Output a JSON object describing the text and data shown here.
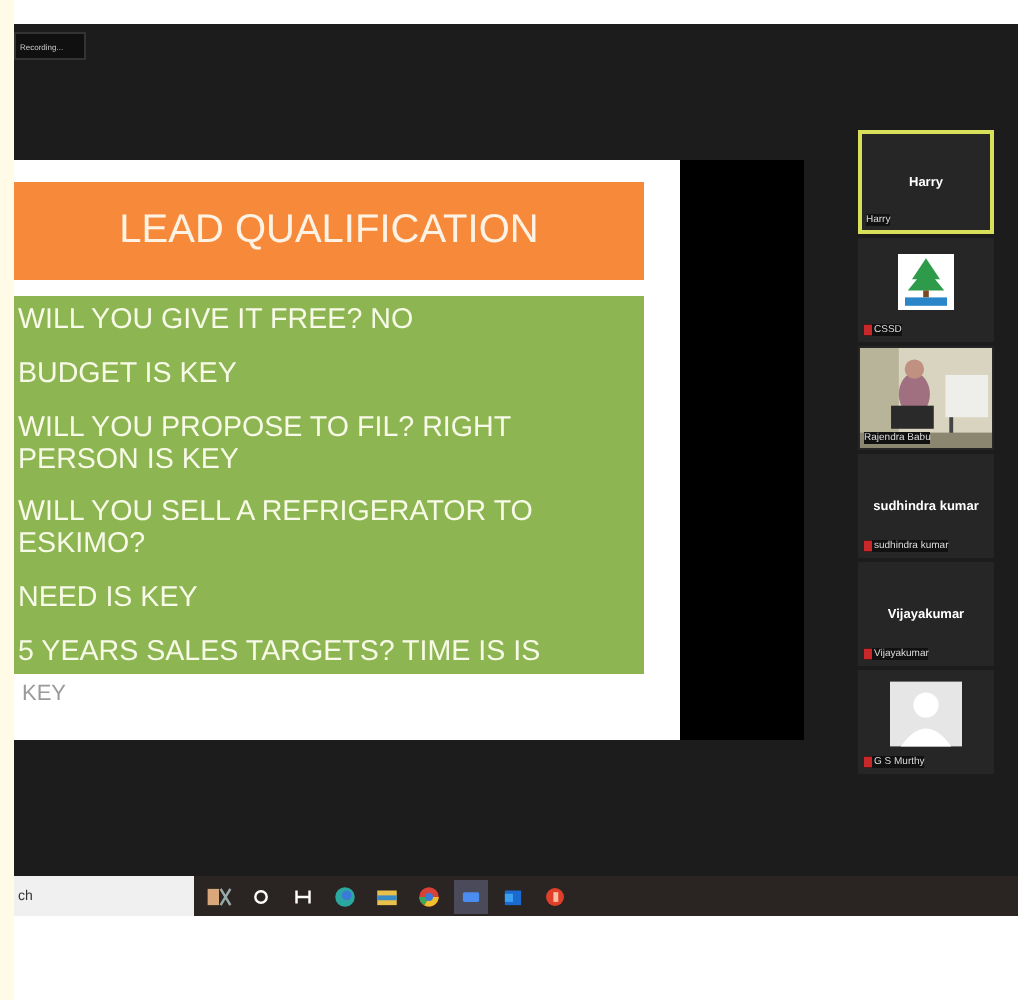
{
  "top_button": {
    "label": "Recording..."
  },
  "slide": {
    "title": "LEAD QUALIFICATION",
    "lines": [
      "WILL YOU GIVE IT FREE? NO",
      "BUDGET IS KEY",
      "WILL YOU PROPOSE TO FIL? RIGHT PERSON IS KEY",
      "WILL YOU SELL A REFRIGERATOR TO ESKIMO?",
      "NEED IS KEY",
      "5 YEARS SALES TARGETS? TIME IS IS"
    ],
    "overflow": "KEY"
  },
  "participants": [
    {
      "kind": "name",
      "display": "Harry",
      "label": "Harry",
      "muted": false,
      "selected": true
    },
    {
      "kind": "logo",
      "label": "CSSD",
      "muted": true,
      "selected": false
    },
    {
      "kind": "video",
      "label": "Rajendra Babu",
      "muted": false,
      "selected": false
    },
    {
      "kind": "name",
      "display": "sudhindra kumar",
      "label": "sudhindra kumar",
      "muted": true,
      "selected": false
    },
    {
      "kind": "name",
      "display": "Vijayakumar",
      "label": "Vijayakumar",
      "muted": true,
      "selected": false
    },
    {
      "kind": "avatar",
      "label": "G S Murthy",
      "muted": true,
      "selected": false
    }
  ],
  "taskbar": {
    "search": {
      "value": "ch"
    }
  }
}
